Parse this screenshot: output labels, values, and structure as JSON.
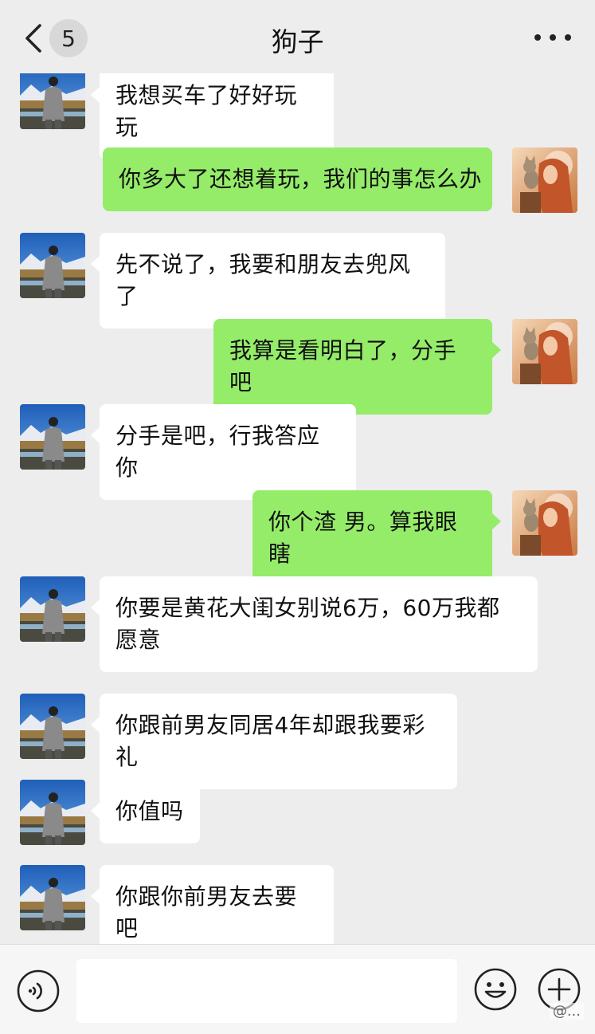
{
  "header": {
    "title": "狗子",
    "unread_count": "5"
  },
  "messages": [
    {
      "side": "in",
      "text": "我想买车了好好玩玩"
    },
    {
      "side": "out",
      "text": "你多大了还想着玩，我们的事怎么办"
    },
    {
      "side": "in",
      "text": "先不说了，我要和朋友去兜风了"
    },
    {
      "side": "out",
      "text": "我算是看明白了，分手吧"
    },
    {
      "side": "in",
      "text": "分手是吧，行我答应你"
    },
    {
      "side": "out",
      "text": "你个渣 男。算我眼瞎"
    },
    {
      "side": "in",
      "text": "你要是黄花大闺女别说6万，60万我都愿意"
    },
    {
      "side": "in",
      "text": "你跟前男友同居4年却跟我要彩礼"
    },
    {
      "side": "in",
      "text": "你值吗"
    },
    {
      "side": "in",
      "text": "你跟你前男友去要吧"
    }
  ],
  "input": {
    "value": "",
    "placeholder": ""
  },
  "watermark": "@..."
}
